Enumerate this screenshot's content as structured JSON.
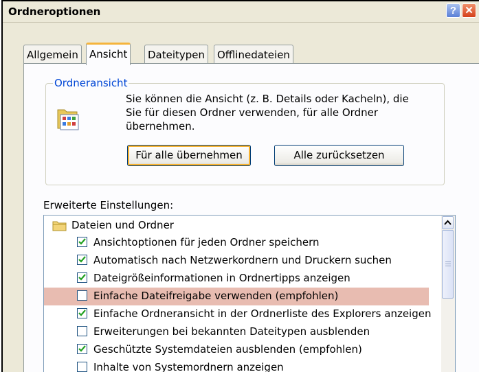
{
  "window": {
    "title": "Ordneroptionen",
    "help_label": "?",
    "close_label": "✕"
  },
  "tabs": [
    {
      "label": "Allgemein",
      "active": false
    },
    {
      "label": "Ansicht",
      "active": true
    },
    {
      "label": "Dateitypen",
      "active": false
    },
    {
      "label": "Offlinedateien",
      "active": false
    }
  ],
  "folder_view": {
    "legend": "Ordneransicht",
    "description": "Sie können die Ansicht (z. B. Details oder Kacheln), die Sie für diesen Ordner verwenden, für alle Ordner übernehmen.",
    "apply_all_label": "Für alle übernehmen",
    "reset_all_label": "Alle zurücksetzen"
  },
  "advanced": {
    "label": "Erweiterte Einstellungen:",
    "category": "Dateien und Ordner",
    "items": [
      {
        "label": "Ansichtoptionen für jeden Ordner speichern",
        "checked": true,
        "highlighted": false
      },
      {
        "label": "Automatisch nach Netzwerkordnern und Druckern suchen",
        "checked": true,
        "highlighted": false
      },
      {
        "label": "Dateigrößeinformationen in Ordnertipps anzeigen",
        "checked": true,
        "highlighted": false
      },
      {
        "label": "Einfache Dateifreigabe verwenden (empfohlen)",
        "checked": false,
        "highlighted": true
      },
      {
        "label": "Einfache Ordneransicht in der Ordnerliste des Explorers anzeigen",
        "checked": true,
        "highlighted": false
      },
      {
        "label": "Erweiterungen bei bekannten Dateitypen ausblenden",
        "checked": false,
        "highlighted": false
      },
      {
        "label": "Geschützte Systemdateien ausblenden (empfohlen)",
        "checked": true,
        "highlighted": false
      },
      {
        "label": "Inhalte von Systemordnern anzeigen",
        "checked": false,
        "highlighted": false
      }
    ]
  },
  "colors": {
    "highlight": "#e8bcb1",
    "legend_text": "#0046d5",
    "window_bg": "#ece9d8"
  }
}
